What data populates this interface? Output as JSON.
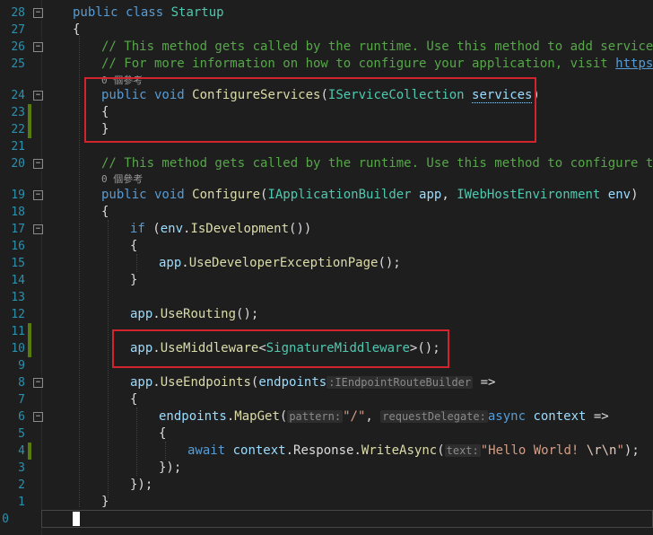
{
  "lines": [
    {
      "num": "28",
      "fold": "⊟",
      "mod": false
    },
    {
      "num": "27",
      "fold": "",
      "mod": false
    },
    {
      "num": "26",
      "fold": "⊟",
      "mod": false
    },
    {
      "num": "25",
      "fold": "",
      "mod": false
    },
    {
      "num": "24",
      "fold": "⊟",
      "mod": false
    },
    {
      "num": "23",
      "fold": "",
      "mod": true
    },
    {
      "num": "22",
      "fold": "",
      "mod": true
    },
    {
      "num": "21",
      "fold": "",
      "mod": false
    },
    {
      "num": "20",
      "fold": "⊟",
      "mod": false
    },
    {
      "num": "19",
      "fold": "⊟",
      "mod": false
    },
    {
      "num": "18",
      "fold": "",
      "mod": false
    },
    {
      "num": "17",
      "fold": "⊟",
      "mod": false
    },
    {
      "num": "16",
      "fold": "",
      "mod": false
    },
    {
      "num": "15",
      "fold": "",
      "mod": false
    },
    {
      "num": "14",
      "fold": "",
      "mod": false
    },
    {
      "num": "13",
      "fold": "",
      "mod": false
    },
    {
      "num": "12",
      "fold": "",
      "mod": false
    },
    {
      "num": "11",
      "fold": "",
      "mod": true
    },
    {
      "num": "10",
      "fold": "",
      "mod": true
    },
    {
      "num": "9",
      "fold": "",
      "mod": false
    },
    {
      "num": "8",
      "fold": "⊟",
      "mod": false
    },
    {
      "num": "7",
      "fold": "",
      "mod": false
    },
    {
      "num": "6",
      "fold": "⊟",
      "mod": false
    },
    {
      "num": "5",
      "fold": "",
      "mod": false
    },
    {
      "num": "4",
      "fold": "",
      "mod": true
    },
    {
      "num": "3",
      "fold": "",
      "mod": false
    },
    {
      "num": "2",
      "fold": "",
      "mod": false
    },
    {
      "num": "1",
      "fold": "",
      "mod": false
    },
    {
      "num": "0",
      "fold": "",
      "mod": false
    }
  ],
  "code": {
    "class_kw": "public class",
    "class_name": "Startup",
    "brace_open": "{",
    "brace_close": "}",
    "comment1": "// This method gets called by the runtime. Use this method to add services to",
    "comment2_a": "// For more information on how to configure your application, visit ",
    "comment2_url": "https://g",
    "refs1": "0 個參考",
    "cs_kw": "public void",
    "cs_name": "ConfigureServices",
    "cs_paren": "(",
    "cs_type": "IServiceCollection",
    "cs_param": "services",
    "cs_close": ")",
    "comment3": "// This method gets called by the runtime. Use this method to configure the H",
    "refs2": "0 個參考",
    "cf_kw": "public void",
    "cf_name": "Configure",
    "cf_args_a": "(",
    "cf_type1": "IApplicationBuilder",
    "cf_param1": "app",
    "cf_comma": ", ",
    "cf_type2": "IWebHostEnvironment",
    "cf_param2": "env",
    "cf_close": ")",
    "if_kw": "if",
    "if_open": " (",
    "if_env": "env",
    "if_dot": ".",
    "if_fn": "IsDevelopment",
    "if_close": "())",
    "ude_app": "app",
    "ude_fn": "UseDeveloperExceptionPage",
    "ude_end": "();",
    "ur_app": "app",
    "ur_fn": "UseRouting",
    "ur_end": "();",
    "um_app": "app",
    "um_fn": "UseMiddleware",
    "um_lt": "<",
    "um_type": "SignatureMiddleware",
    "um_end": ">();",
    "ue_app": "app",
    "ue_fn": "UseEndpoints",
    "ue_open": "(",
    "ue_param": "endpoints",
    "ue_hint": ":IEndpointRouteBuilder",
    "ue_arrow": " =>",
    "mg_ep": "endpoints",
    "mg_fn": "MapGet",
    "mg_open": "(",
    "mg_hint1": "pattern:",
    "mg_str": "\"/\"",
    "mg_comma": ", ",
    "mg_hint2": "requestDelegate:",
    "mg_async": "async",
    "mg_ctx": " context",
    "mg_arrow": " =>",
    "aw_kw": "await",
    "aw_ctx": " context",
    "aw_resp": ".Response.",
    "aw_fn": "WriteAsync",
    "aw_open": "(",
    "aw_hint": "text:",
    "aw_str1": "\"Hello World! ",
    "aw_esc": "\\r\\n",
    "aw_str2": "\"",
    "aw_end": ");",
    "close_paren": "});",
    "close_paren2": "});"
  }
}
